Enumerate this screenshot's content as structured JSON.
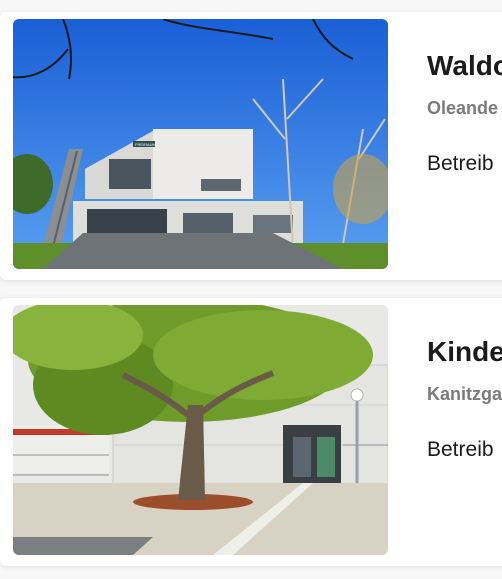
{
  "cards": [
    {
      "title": "Waldo",
      "street": "Oleande",
      "operator": "Betreib",
      "image_label": "FREIRAUM",
      "colors": {
        "sky": "#1e6fe0",
        "building": "#e8e8e6",
        "lawn": "#5f8f2a"
      }
    },
    {
      "title": "Kinde",
      "street": "Kanitzga",
      "operator": "Betreib",
      "colors": {
        "sky": "#e6e6e2",
        "building": "#dcdcd8",
        "tree": "#6f9b2a"
      }
    }
  ]
}
